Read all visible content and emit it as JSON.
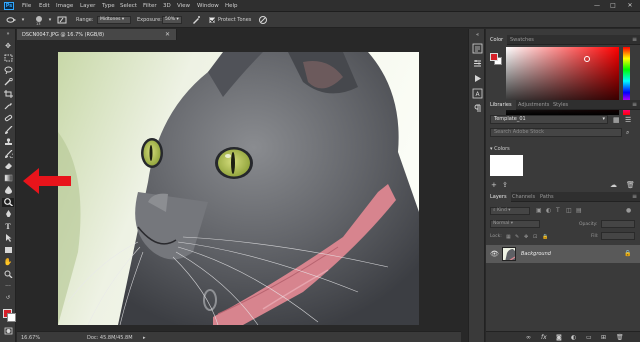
{
  "app": {
    "logo": "Ps"
  },
  "menu": [
    "File",
    "Edit",
    "Image",
    "Layer",
    "Type",
    "Select",
    "Filter",
    "3D",
    "View",
    "Window",
    "Help"
  ],
  "window_controls": {
    "minimize": "—",
    "maximize": "□",
    "close": "✕"
  },
  "options_bar": {
    "brush_size": "13",
    "range_label": "Range:",
    "range_value": "Midtones",
    "exposure_label": "Exposure:",
    "exposure_value": "50%",
    "protect_tones_label": "Protect Tones"
  },
  "document": {
    "tab_title": "DSCN0047.JPG @ 16.7% (RGB/8)",
    "close": "✕",
    "zoom": "16.67%",
    "doc_size": "Doc: 45.8M/45.8M"
  },
  "color_panel": {
    "tabs": [
      "Color",
      "Swatches"
    ],
    "foreground_color": "#d61f28",
    "background_color": "#ffffff"
  },
  "libraries_panel": {
    "tabs": [
      "Libraries",
      "Adjustments",
      "Styles"
    ],
    "library_name": "Template_01",
    "search_placeholder": "Search Adobe Stock",
    "colors_label": "Colors",
    "swatch_color": "#ffffff"
  },
  "layers_panel": {
    "tabs": [
      "Layers",
      "Channels",
      "Paths"
    ],
    "kind_placeholder": "Kind",
    "blend_mode": "Normal",
    "opacity_label": "Opacity:",
    "lock_label": "Lock:",
    "fill_label": "Fill:",
    "layers": [
      {
        "name": "Background",
        "visible": true,
        "locked": true
      }
    ]
  },
  "annotation": {
    "arrow_color": "#e8141b",
    "points_to": "dodge-tool"
  }
}
